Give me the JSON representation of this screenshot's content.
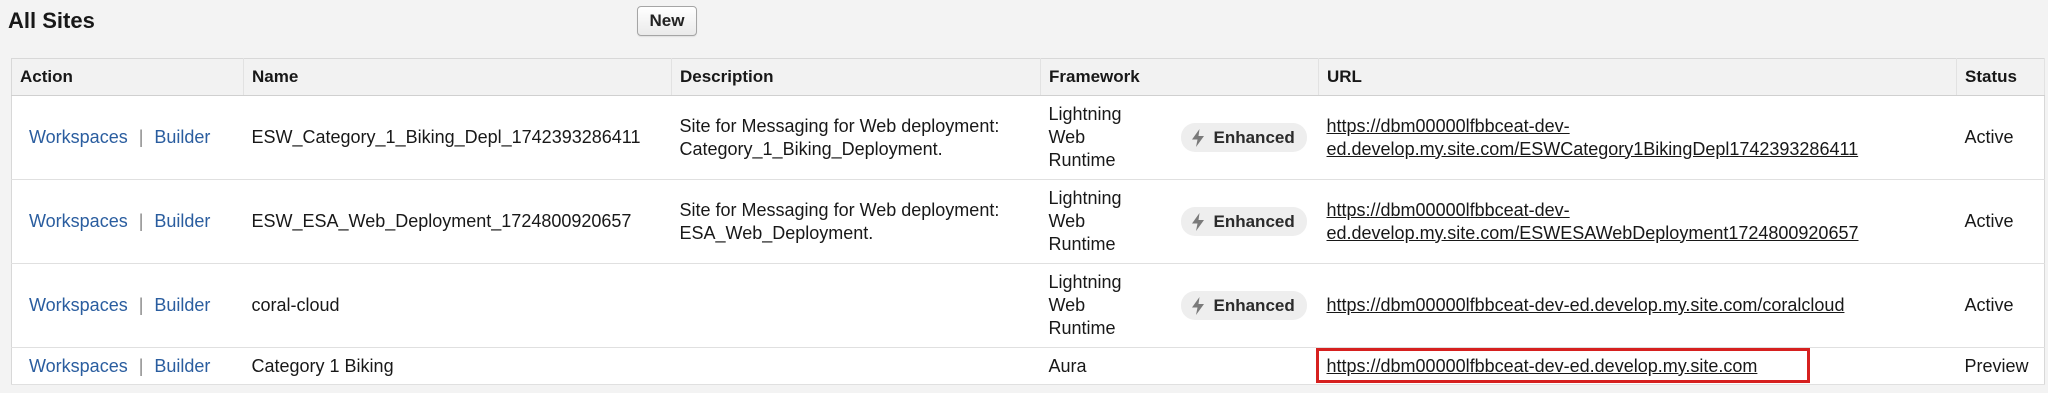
{
  "page": {
    "title": "All Sites",
    "new_button_label": "New"
  },
  "table": {
    "headers": {
      "action": "Action",
      "name": "Name",
      "description": "Description",
      "framework": "Framework",
      "url": "URL",
      "status": "Status"
    },
    "rows": [
      {
        "workspaces": "Workspaces",
        "separator": "|",
        "builder": "Builder",
        "name": "ESW_Category_1_Biking_Depl_1742393286411",
        "description_line1": "Site for Messaging for Web deployment:",
        "description_line2": "Category_1_Biking_Deployment.",
        "framework_line1": "Lightning",
        "framework_line2": "Web",
        "framework_line3": "Runtime",
        "badge": "Enhanced",
        "url_line1": "https://dbm00000lfbbceat-dev-",
        "url_line2": "ed.develop.my.site.com/ESWCategory1BikingDepl1742393286411",
        "status": "Active"
      },
      {
        "workspaces": "Workspaces",
        "separator": "|",
        "builder": "Builder",
        "name": "ESW_ESA_Web_Deployment_1724800920657",
        "description_line1": "Site for Messaging for Web deployment:",
        "description_line2": "ESA_Web_Deployment.",
        "framework_line1": "Lightning",
        "framework_line2": "Web",
        "framework_line3": "Runtime",
        "badge": "Enhanced",
        "url_line1": "https://dbm00000lfbbceat-dev-",
        "url_line2": "ed.develop.my.site.com/ESWESAWebDeployment1724800920657",
        "status": "Active"
      },
      {
        "workspaces": "Workspaces",
        "separator": "|",
        "builder": "Builder",
        "name": "coral-cloud",
        "description_line1": "",
        "description_line2": "",
        "framework_line1": "Lightning",
        "framework_line2": "Web",
        "framework_line3": "Runtime",
        "badge": "Enhanced",
        "url_line1": "https://dbm00000lfbbceat-dev-ed.develop.my.site.com/coralcloud",
        "url_line2": "",
        "status": "Active"
      },
      {
        "workspaces": "Workspaces",
        "separator": "|",
        "builder": "Builder",
        "name": "Category 1 Biking",
        "framework": "Aura",
        "url": "https://dbm00000lfbbceat-dev-ed.develop.my.site.com",
        "status": "Preview"
      }
    ]
  },
  "colors": {
    "link": "#2a5d9f",
    "highlight": "#d6201f",
    "badge_bg": "#eeeeee"
  },
  "icons": {
    "badge_icon": "lightning-bolt-icon"
  }
}
